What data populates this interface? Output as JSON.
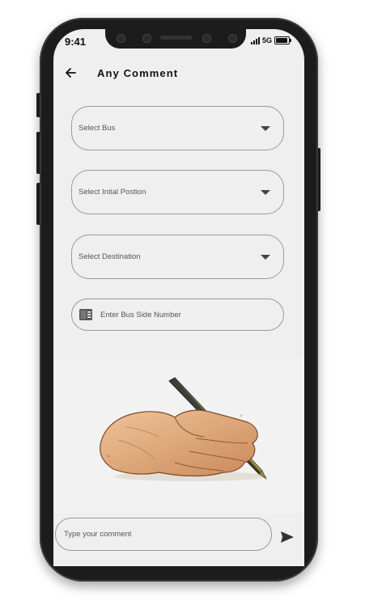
{
  "status_bar": {
    "time": "9:41",
    "network": "5G"
  },
  "header": {
    "title": "Any Comment",
    "back_icon": "arrow-left-icon"
  },
  "form": {
    "select_bus": {
      "label": "Select Bus",
      "icon": "caret-down-icon"
    },
    "select_initial_position": {
      "label": "Select Intial Postion",
      "icon": "caret-down-icon"
    },
    "select_destination": {
      "label": "Select Destination",
      "icon": "caret-down-icon"
    },
    "bus_side_number": {
      "placeholder": "Enter Bus Side Number",
      "icon": "id-card-icon"
    }
  },
  "illustration": {
    "subject": "hand-writing-with-pen"
  },
  "comment": {
    "placeholder": "Type your comment",
    "send_icon": "send-icon"
  },
  "colors": {
    "screen_bg": "#efefef",
    "phone_frame": "#1c1c1c",
    "field_border": "#9a9a9a",
    "text": "#111111",
    "pen_gold": "#b8a030"
  }
}
